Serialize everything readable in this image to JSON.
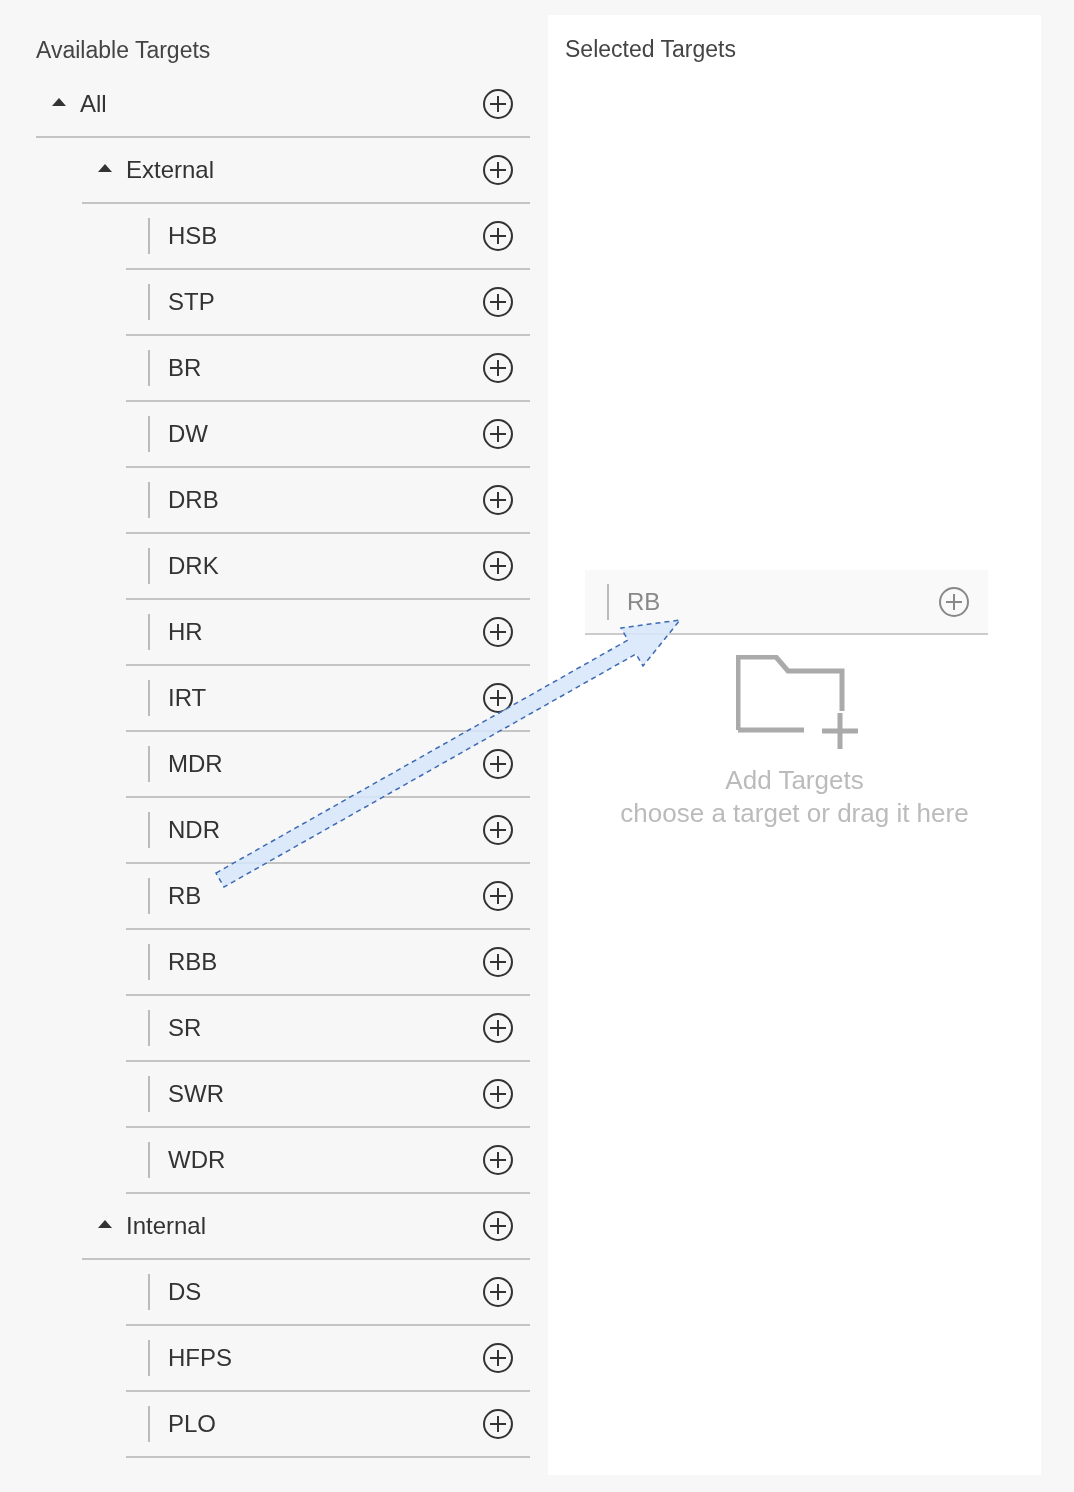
{
  "available": {
    "title": "Available Targets",
    "tree": [
      {
        "label": "All",
        "kind": "group",
        "expanded": true,
        "children": [
          {
            "label": "External",
            "kind": "group",
            "expanded": true,
            "children": [
              {
                "label": "HSB",
                "kind": "leaf"
              },
              {
                "label": "STP",
                "kind": "leaf"
              },
              {
                "label": "BR",
                "kind": "leaf"
              },
              {
                "label": "DW",
                "kind": "leaf"
              },
              {
                "label": "DRB",
                "kind": "leaf"
              },
              {
                "label": "DRK",
                "kind": "leaf"
              },
              {
                "label": "HR",
                "kind": "leaf"
              },
              {
                "label": "IRT",
                "kind": "leaf"
              },
              {
                "label": "MDR",
                "kind": "leaf"
              },
              {
                "label": "NDR",
                "kind": "leaf"
              },
              {
                "label": "RB",
                "kind": "leaf"
              },
              {
                "label": "RBB",
                "kind": "leaf"
              },
              {
                "label": "SR",
                "kind": "leaf"
              },
              {
                "label": "SWR",
                "kind": "leaf"
              },
              {
                "label": "WDR",
                "kind": "leaf"
              }
            ]
          },
          {
            "label": "Internal",
            "kind": "group",
            "expanded": true,
            "children": [
              {
                "label": "DS",
                "kind": "leaf"
              },
              {
                "label": "HFPS",
                "kind": "leaf"
              },
              {
                "label": "PLO",
                "kind": "leaf"
              }
            ]
          }
        ]
      }
    ]
  },
  "selected": {
    "title": "Selected Targets",
    "drag_item": {
      "label": "RB"
    },
    "empty_state": {
      "title": "Add Targets",
      "hint": "choose a target or drag it here"
    }
  }
}
